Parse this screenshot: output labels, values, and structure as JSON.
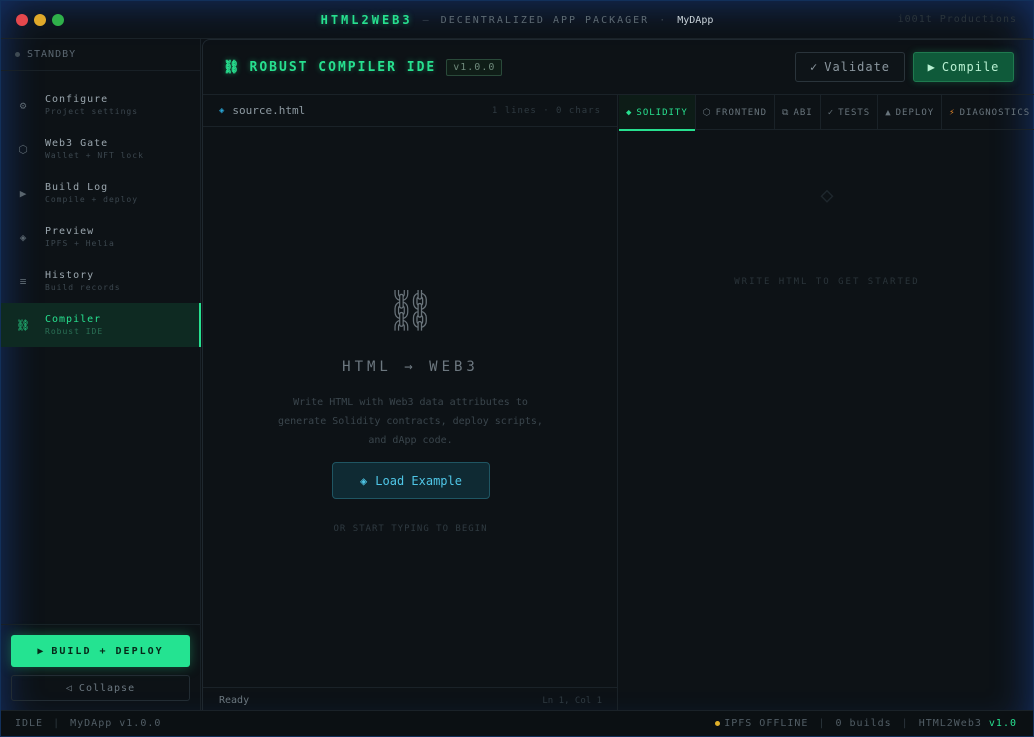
{
  "titlebar": {
    "app_name": "HTML2WEB3",
    "dash": "—",
    "subtitle": "DECENTRALIZED APP PACKAGER",
    "sep": "·",
    "project": "MyDApp",
    "brand": "i001t Productions"
  },
  "sidebar": {
    "status": "STANDBY",
    "items": [
      {
        "icon": "⚙",
        "icon_name": "gear-icon",
        "label": "Configure",
        "sub": "Project settings",
        "active": false
      },
      {
        "icon": "⬡",
        "icon_name": "hexagon-icon",
        "label": "Web3 Gate",
        "sub": "Wallet + NFT lock",
        "active": false
      },
      {
        "icon": "▶",
        "icon_name": "play-icon",
        "label": "Build Log",
        "sub": "Compile + deploy",
        "active": false
      },
      {
        "icon": "◈",
        "icon_name": "preview-icon",
        "label": "Preview",
        "sub": "IPFS + Helia",
        "active": false
      },
      {
        "icon": "≡",
        "icon_name": "list-icon",
        "label": "History",
        "sub": "Build records",
        "active": false
      },
      {
        "icon": "⛓",
        "icon_name": "chain-icon",
        "label": "Compiler",
        "sub": "Robust IDE",
        "active": true
      }
    ],
    "build_label": "BUILD + DEPLOY",
    "build_icon": "▶",
    "collapse_label": "Collapse",
    "collapse_icon": "◁"
  },
  "header": {
    "icon": "⛓",
    "title": "ROBUST COMPILER IDE",
    "version": "v1.0.0",
    "validate_label": "Validate",
    "validate_icon": "✓",
    "compile_label": "Compile",
    "compile_icon": "▶"
  },
  "editor": {
    "file_icon": "◈",
    "file_name": "source.html",
    "stats": "1 lines · 0 chars",
    "empty_icon": "⛓",
    "heading": "HTML → WEB3",
    "description": "Write HTML with Web3 data attributes to generate Solidity contracts, deploy scripts, and dApp code.",
    "load_icon": "◈",
    "load_label": "Load Example",
    "hint": "OR START TYPING TO BEGIN",
    "status": "Ready",
    "cursor": "Ln 1, Col 1"
  },
  "output": {
    "tabs": [
      {
        "icon": "◆",
        "icon_name": "diamond-icon",
        "label": "SOLIDITY",
        "active": true
      },
      {
        "icon": "⬡",
        "icon_name": "hexagon-icon",
        "label": "FRONTEND",
        "active": false
      },
      {
        "icon": "⧉",
        "icon_name": "copy-icon",
        "label": "ABI",
        "active": false
      },
      {
        "icon": "✓",
        "icon_name": "check-icon",
        "label": "TESTS",
        "active": false
      },
      {
        "icon": "▲",
        "icon_name": "triangle-icon",
        "label": "DEPLOY",
        "active": false
      },
      {
        "icon": "⚡",
        "icon_name": "bolt-icon",
        "label": "DIAGNOSTICS",
        "active": false
      }
    ],
    "empty_icon": "◇",
    "empty_text": "WRITE HTML TO GET STARTED"
  },
  "statusbar": {
    "state": "IDLE",
    "sep": "|",
    "project": "MyDApp v1.0.0",
    "ipfs": "IPFS OFFLINE",
    "builds": "0 builds",
    "brand": "HTML2Web3",
    "version": "v1.0"
  },
  "colors": {
    "accent": "#27e08f",
    "ipfs_status": "#e0b02a",
    "link": "#4fc6e6"
  }
}
